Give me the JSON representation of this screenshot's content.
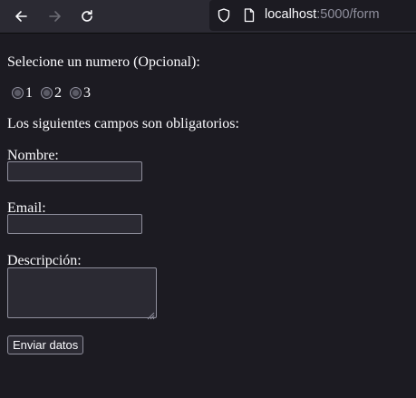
{
  "browser": {
    "url_host": "localhost",
    "url_rest": ":5000/form"
  },
  "form": {
    "radio_prompt": "Selecione un numero (Opcional):",
    "radio_options": [
      "1",
      "2",
      "3"
    ],
    "required_note": "Los siguientes campos son obligatorios:",
    "name_label": "Nombre:",
    "email_label": "Email:",
    "description_label": "Descripción:",
    "submit_label": "Enviar datos"
  }
}
